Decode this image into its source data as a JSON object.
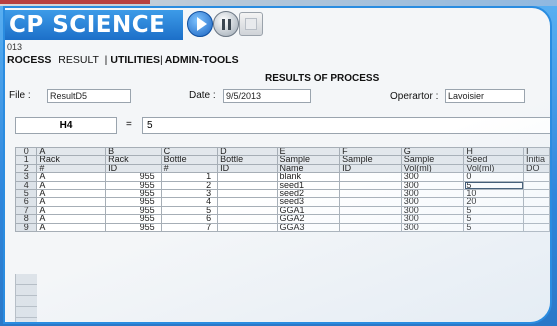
{
  "app": {
    "brand": "CP SCIENCE",
    "year_fragment": "013"
  },
  "menu": {
    "process": "ROCESS",
    "result": "RESULT",
    "utilities": "UTILITIES",
    "admin": "ADMIN-TOOLS",
    "sep": "|"
  },
  "header": {
    "title": "RESULTS OF PROCESS",
    "file_label": "File :",
    "file_value": "ResultD5",
    "date_label": "Date :",
    "date_value": "9/5/2013",
    "operator_label": "Operartor :",
    "operator_value": "Lavoisier"
  },
  "cellref": {
    "ref": "H4",
    "eq": "=",
    "formula": "5"
  },
  "grid": {
    "columns": [
      "0",
      "A",
      "B",
      "C",
      "D",
      "E",
      "F",
      "G",
      "H",
      "I"
    ],
    "rows": [
      [
        "1",
        "Rack",
        "Rack",
        "Bottle",
        "Bottle",
        "Sample",
        "Sample",
        "Sample",
        "Seed",
        "Initia"
      ],
      [
        "2",
        "#",
        "ID",
        "#",
        "ID",
        "Name",
        "ID",
        "Vol(ml)",
        "Vol(ml)",
        "DO"
      ],
      [
        "3",
        "A",
        "955",
        "1",
        "",
        "blank",
        "",
        "300",
        "0",
        ""
      ],
      [
        "4",
        "A",
        "955",
        "2",
        "",
        "seed1",
        "",
        "300",
        "5",
        ""
      ],
      [
        "5",
        "A",
        "955",
        "3",
        "",
        "seed2",
        "",
        "300",
        "10",
        ""
      ],
      [
        "6",
        "A",
        "955",
        "4",
        "",
        "seed3",
        "",
        "300",
        "20",
        ""
      ],
      [
        "7",
        "A",
        "955",
        "5",
        "",
        "GGA1",
        "",
        "300",
        "5",
        ""
      ],
      [
        "8",
        "A",
        "955",
        "6",
        "",
        "GGA2",
        "",
        "300",
        "5",
        ""
      ],
      [
        "9",
        "A",
        "955",
        "7",
        "",
        "GGA3",
        "",
        "300",
        "5",
        ""
      ]
    ]
  },
  "icons": {
    "play": "play-icon",
    "pause": "pause-icon",
    "stop": "stop-icon"
  },
  "colors": {
    "frame_blue": "#2a8ce0",
    "brand_blue": "#1c6fc8"
  }
}
